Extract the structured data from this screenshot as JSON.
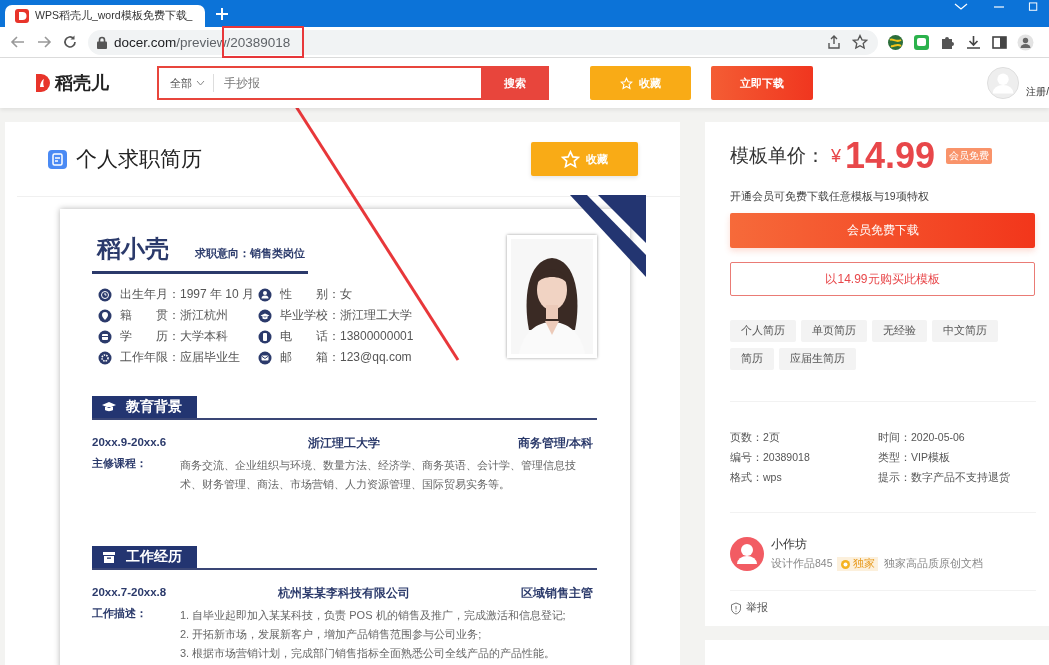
{
  "browser": {
    "tab_title": "WPS稻壳儿_word模板免费下载_",
    "url_host": "docer.com",
    "url_path": "/preview/20389018"
  },
  "header": {
    "logo": "稻壳儿",
    "search_scope": "全部",
    "search_placeholder": "手抄报",
    "search_button": "搜索",
    "favorite_button": "收藏",
    "download_button": "立即下载",
    "user_link": "注册/"
  },
  "document": {
    "title": "个人求职简历",
    "favorite_button": "收藏"
  },
  "resume": {
    "name": "稻小壳",
    "objective": "求职意向：销售类岗位",
    "info": [
      "出生年月：1997 年 10 月",
      "性　　别：女",
      "籍　　贯：浙江杭州",
      "毕业学校：浙江理工大学",
      "学　　历：大学本科",
      "电　　话：13800000001",
      "工作年限：应届毕业生",
      "邮　　箱：123@qq.com"
    ],
    "sections": [
      {
        "kind": "education",
        "title": "教育背景",
        "period": "20xx.9-20xx.6",
        "org": "浙江理工大学",
        "role": "商务管理/本科",
        "detail_label": "主修课程：",
        "details": [
          "商务交流、企业组织与环境、数量方法、经济学、商务英语、会计学、管理信息技术、财务管理、商法、市场营销、人力资源管理、国际贸易实务等。"
        ]
      },
      {
        "kind": "work",
        "title": "工作经历",
        "period": "20xx.7-20xx.8",
        "org": "杭州某某李科技有限公司",
        "role": "区域销售主管",
        "detail_label": "工作描述：",
        "details": [
          "1. 自毕业起即加入某某科技，负责 POS 机的销售及推广，完成激活和信息登记;",
          "2. 开拓新市场，发展新客户，增加产品销售范围参与公司业务;",
          "3. 根据市场营销计划，完成部门销售指标全面熟悉公司全线产品的产品性能。"
        ]
      }
    ]
  },
  "price": {
    "label": "模板单价：",
    "currency": "¥",
    "amount": "14.99",
    "badge": "会员免费",
    "note": "开通会员可免费下载任意模板与19项特权",
    "primary_button": "会员免费下载",
    "secondary_button": "以14.99元购买此模板"
  },
  "tags": [
    "个人简历",
    "单页简历",
    "无经验",
    "中文简历",
    "简历",
    "应届生简历"
  ],
  "meta": [
    "页数：2页",
    "时间：2020-05-06",
    "编号：20389018",
    "类型：VIP模板",
    "格式：wps",
    "提示：数字产品不支持退货"
  ],
  "author": {
    "name": "小作坊",
    "works": "设计作品845",
    "badge": "独家",
    "note": "独家高品质原创文档"
  },
  "report": "举报"
}
